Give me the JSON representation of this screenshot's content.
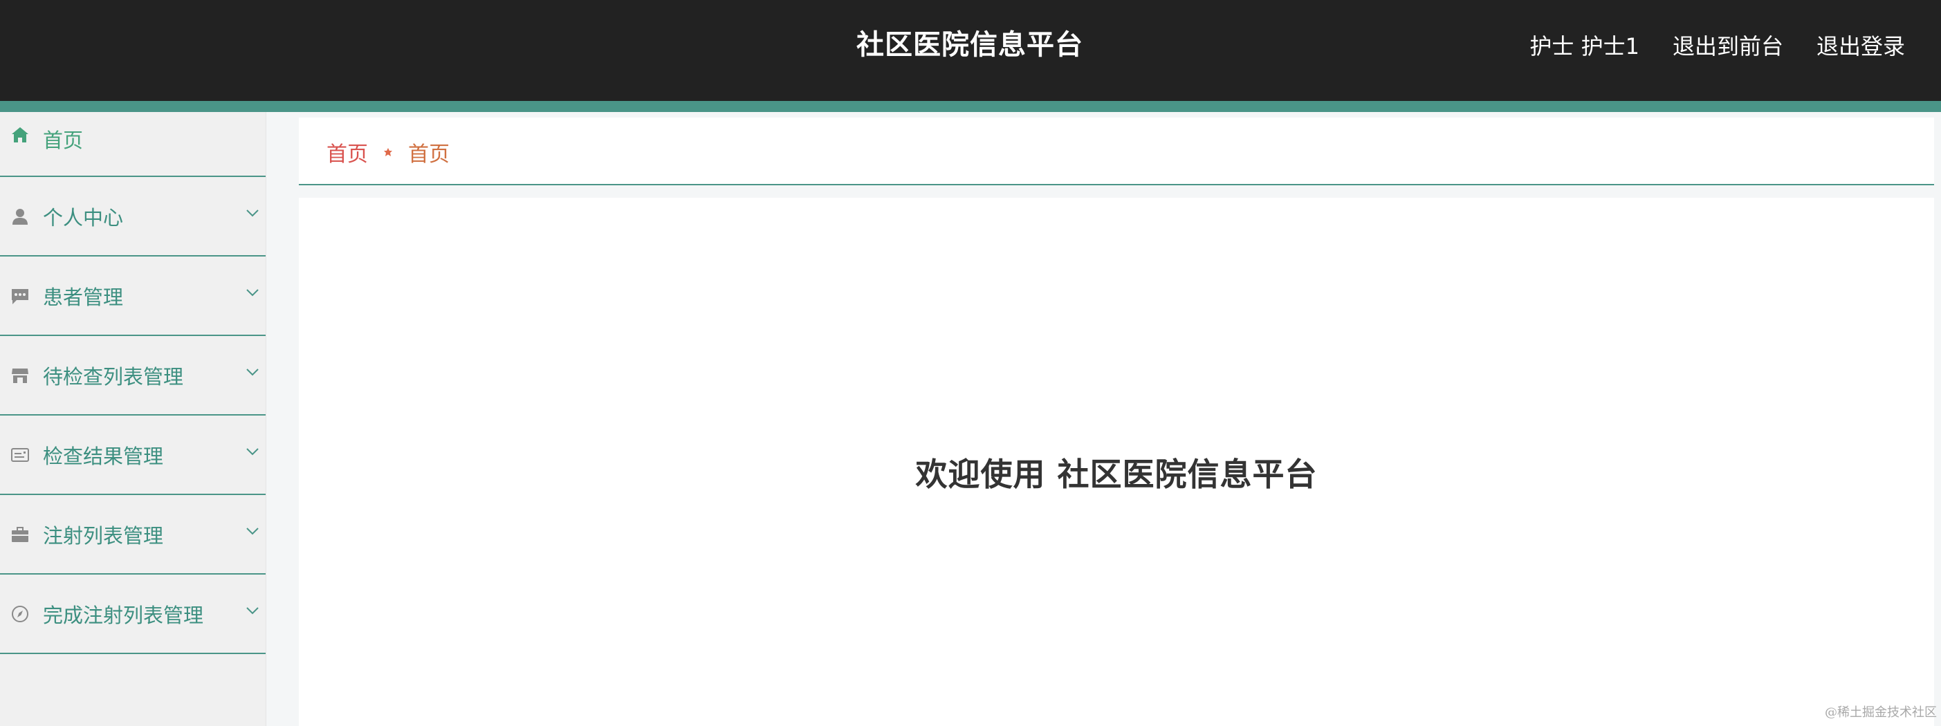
{
  "header": {
    "title": "社区医院信息平台",
    "user_role": "护士",
    "user_name": "护士1",
    "back_to_front_label": "退出到前台",
    "logout_label": "退出登录"
  },
  "sidebar": {
    "items": [
      {
        "label": "首页",
        "icon": "home-icon",
        "expandable": false
      },
      {
        "label": "个人中心",
        "icon": "user-icon",
        "expandable": true
      },
      {
        "label": "患者管理",
        "icon": "chat-icon",
        "expandable": true
      },
      {
        "label": "待检查列表管理",
        "icon": "store-icon",
        "expandable": true
      },
      {
        "label": "检查结果管理",
        "icon": "id-card-icon",
        "expandable": true
      },
      {
        "label": "注射列表管理",
        "icon": "briefcase-icon",
        "expandable": true
      },
      {
        "label": "完成注射列表管理",
        "icon": "compass-icon",
        "expandable": true
      }
    ]
  },
  "breadcrumb": {
    "items": [
      "首页",
      "首页"
    ]
  },
  "main": {
    "welcome_text": "欢迎使用 社区医院信息平台"
  },
  "watermark": "@稀土掘金技术社区",
  "colors": {
    "header_bg": "#222222",
    "accent": "#4a9588",
    "menu_text": "#3c8f80",
    "home_text": "#44a27b",
    "crumb_red": "#d9534f",
    "crumb_orange": "#d07040"
  }
}
